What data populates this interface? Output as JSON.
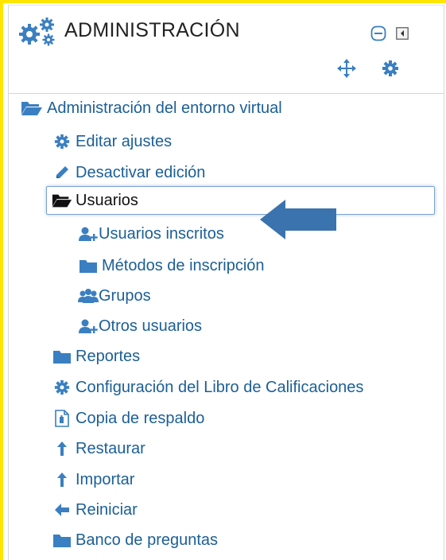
{
  "block": {
    "title": "ADMINISTRACIÓN",
    "accent_color": "#3a7fc1",
    "active_border_color": "#7ba3d6"
  },
  "tree": {
    "root": {
      "label": "Administración del entorno virtual",
      "icon": "folder-open-icon"
    },
    "items": [
      {
        "label": "Editar ajustes",
        "icon": "gear-icon"
      },
      {
        "label": "Desactivar edición",
        "icon": "pencil-icon"
      },
      {
        "label": "Usuarios",
        "icon": "folder-open-icon",
        "active": true
      },
      {
        "label": "Usuarios inscritos",
        "icon": "add-user-icon"
      },
      {
        "label": "Métodos de inscripción",
        "icon": "folder-icon"
      },
      {
        "label": "Grupos",
        "icon": "group-icon"
      },
      {
        "label": "Otros usuarios",
        "icon": "add-user-icon"
      },
      {
        "label": "Reportes",
        "icon": "folder-icon"
      },
      {
        "label": "Configuración del Libro de Calificaciones",
        "icon": "gear-icon"
      },
      {
        "label": "Copia de respaldo",
        "icon": "backup-file-icon"
      },
      {
        "label": "Restaurar",
        "icon": "upload-arrow-icon"
      },
      {
        "label": "Importar",
        "icon": "upload-arrow-icon"
      },
      {
        "label": "Reiniciar",
        "icon": "left-arrow-icon"
      },
      {
        "label": "Banco de preguntas",
        "icon": "folder-icon"
      }
    ]
  }
}
